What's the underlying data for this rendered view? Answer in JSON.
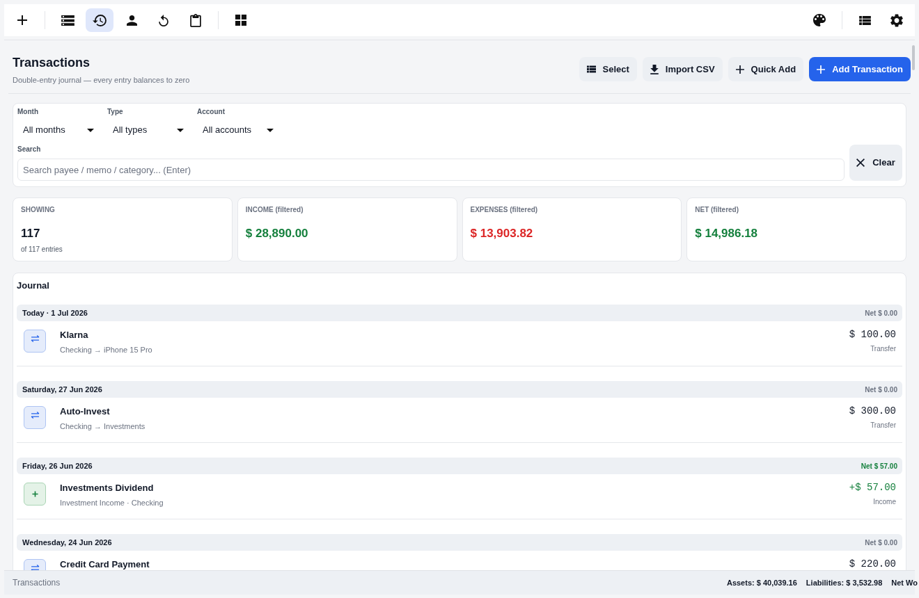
{
  "toolbar": {
    "left": [
      [
        {
          "kind": "add",
          "selected": false
        }
      ],
      [
        {
          "kind": "ledger",
          "selected": false
        },
        {
          "kind": "history",
          "selected": true
        },
        {
          "kind": "person",
          "selected": false
        },
        {
          "kind": "undo",
          "selected": false
        },
        {
          "kind": "clipboard",
          "selected": false
        }
      ],
      [
        {
          "kind": "grid",
          "selected": false
        }
      ]
    ],
    "right": [
      [
        {
          "kind": "palette",
          "selected": false
        }
      ],
      [
        {
          "kind": "list",
          "selected": false
        },
        {
          "kind": "settings",
          "selected": false
        }
      ]
    ]
  },
  "header": {
    "title": "Transactions",
    "subtitle": "Double-entry journal — every entry balances to zero",
    "actions": [
      {
        "kind": "list",
        "label": "Select",
        "primary": false
      },
      {
        "kind": "download",
        "label": "Import CSV",
        "primary": false
      },
      {
        "kind": "add",
        "label": "Quick Add",
        "primary": false
      },
      {
        "kind": "add",
        "label": "Add Transaction",
        "primary": true
      }
    ]
  },
  "filters": {
    "selects": [
      {
        "label": "Month",
        "value": "All months"
      },
      {
        "label": "Type",
        "value": "All types"
      },
      {
        "label": "Account",
        "value": "All accounts"
      }
    ],
    "search": {
      "label": "Search",
      "placeholder": "Search payee / memo / category... (Enter)"
    },
    "clear_button": "Clear"
  },
  "stats": [
    {
      "label": "SHOWING",
      "value": "117",
      "note": "of 117 entries",
      "color": "#111827"
    },
    {
      "label": "INCOME (filtered)",
      "value": "$ 28,890.00",
      "color": "#15803d"
    },
    {
      "label": "EXPENSES (filtered)",
      "value": "$ 13,903.82",
      "color": "#dc2626"
    },
    {
      "label": "NET (filtered)",
      "value": "$ 14,986.18",
      "color": "#15803d"
    }
  ],
  "journal": {
    "title": "Journal",
    "groups": [
      {
        "date": "Today · 1 Jul 2026",
        "net": "Net $ 0.00",
        "color": "#6b7280",
        "entries": [
          {
            "kind": "transfer",
            "payee": "Klarna",
            "detail": "Checking → iPhone 15 Pro",
            "amount": "$ 100.00",
            "type": "Transfer"
          }
        ]
      },
      {
        "date": "Saturday, 27 Jun 2026",
        "net": "Net $ 0.00",
        "color": "#6b7280",
        "entries": [
          {
            "kind": "transfer",
            "payee": "Auto-Invest",
            "detail": "Checking → Investments",
            "amount": "$ 300.00",
            "type": "Transfer"
          }
        ]
      },
      {
        "date": "Friday, 26 Jun 2026",
        "net": "Net $ 57.00",
        "color": "#15803d",
        "entries": [
          {
            "kind": "income",
            "payee": "Investments Dividend",
            "detail": "Investment Income · Checking",
            "amount": "+$ 57.00",
            "type": "Income"
          }
        ]
      },
      {
        "date": "Wednesday, 24 Jun 2026",
        "net": "Net $ 0.00",
        "color": "#6b7280",
        "entries": [
          {
            "kind": "transfer",
            "payee": "Credit Card Payment",
            "amount": "$ 220.00"
          }
        ]
      }
    ]
  },
  "status_bar": {
    "title": "Transactions",
    "items": [
      "Assets: $ 40,039.16",
      "Liabilities: $ 3,532.98",
      "Net Wo"
    ]
  }
}
